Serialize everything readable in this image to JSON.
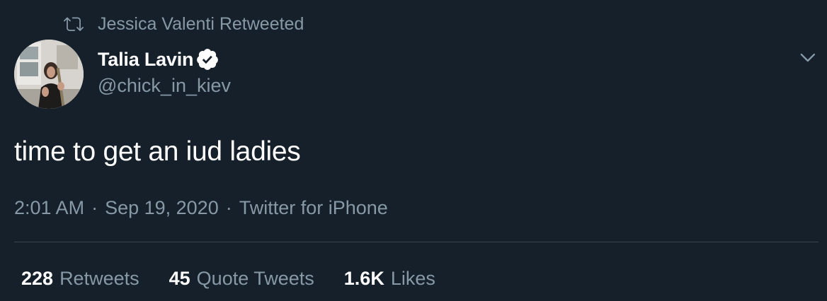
{
  "retweet": {
    "icon": "retweet-icon",
    "text": "Jessica Valenti Retweeted"
  },
  "author": {
    "name": "Talia Lavin",
    "handle": "@chick_in_kiev",
    "verified": true,
    "verified_icon": "verified-badge-icon"
  },
  "tweet": {
    "text": "time to get an iud ladies",
    "time": "2:01 AM",
    "date": "Sep 19, 2020",
    "source": "Twitter for iPhone",
    "separator": "·"
  },
  "stats": [
    {
      "count": "228",
      "label": "Retweets"
    },
    {
      "count": "45",
      "label": "Quote Tweets"
    },
    {
      "count": "1.6K",
      "label": "Likes"
    }
  ],
  "colors": {
    "background": "#15202b",
    "primary_text": "#ffffff",
    "secondary_text": "#8899a6",
    "divider": "#38444d"
  }
}
